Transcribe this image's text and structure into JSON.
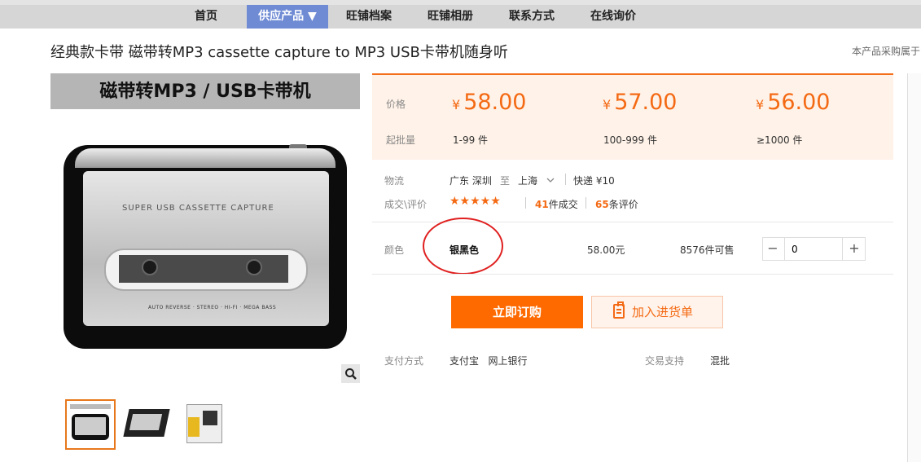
{
  "nav": {
    "items": [
      {
        "label": "首页"
      },
      {
        "label": "供应产品 ▼"
      },
      {
        "label": "旺铺档案"
      },
      {
        "label": "旺铺相册"
      },
      {
        "label": "联系方式"
      },
      {
        "label": "在线询价"
      }
    ],
    "active_index": 1
  },
  "product": {
    "title": "经典款卡带 磁带转MP3 cassette capture to MP3 USB卡带机随身听",
    "side_note": "本产品采购属于"
  },
  "gallery": {
    "banner_text": "磁带转MP3 / USB卡带机",
    "device_text": "SUPER USB CASSETTE CAPTURE",
    "device_small_text": "AUTO REVERSE · STEREO · HI-FI · MEGA BASS",
    "zoom_icon": "magnifier-icon",
    "thumbnails": 3
  },
  "pricing": {
    "price_label": "价格",
    "qty_label": "起批量",
    "currency": "¥",
    "tiers": [
      {
        "price": "58.00",
        "qty": "1-99 件"
      },
      {
        "price": "57.00",
        "qty": "100-999 件"
      },
      {
        "price": "56.00",
        "qty": "≥1000 件"
      }
    ]
  },
  "logistics": {
    "label": "物流",
    "from": "广东 深圳",
    "to_word": "至",
    "to": "上海",
    "shipping": "快递 ¥10"
  },
  "reviews": {
    "label": "成交\\评价",
    "stars": "★★★★★",
    "rating": 5,
    "deals_count": "41",
    "deals_text": "件成交",
    "review_count": "65",
    "review_text": "条评价"
  },
  "variant": {
    "label": "颜色",
    "name": "银黑色",
    "price": "58.00元",
    "stock": "8576件可售",
    "quantity": "0",
    "minus": "−",
    "plus": "+"
  },
  "actions": {
    "buy_label": "立即订购",
    "cart_label": "加入进货单"
  },
  "payment": {
    "label": "支付方式",
    "methods": "支付宝   网上银行",
    "support_label": "交易支持",
    "support_value": "混批"
  },
  "colors": {
    "accent": "#ff6a00",
    "price": "#f46a14",
    "nav_active": "#6f8bd4",
    "annotation_circle": "#e02020"
  }
}
